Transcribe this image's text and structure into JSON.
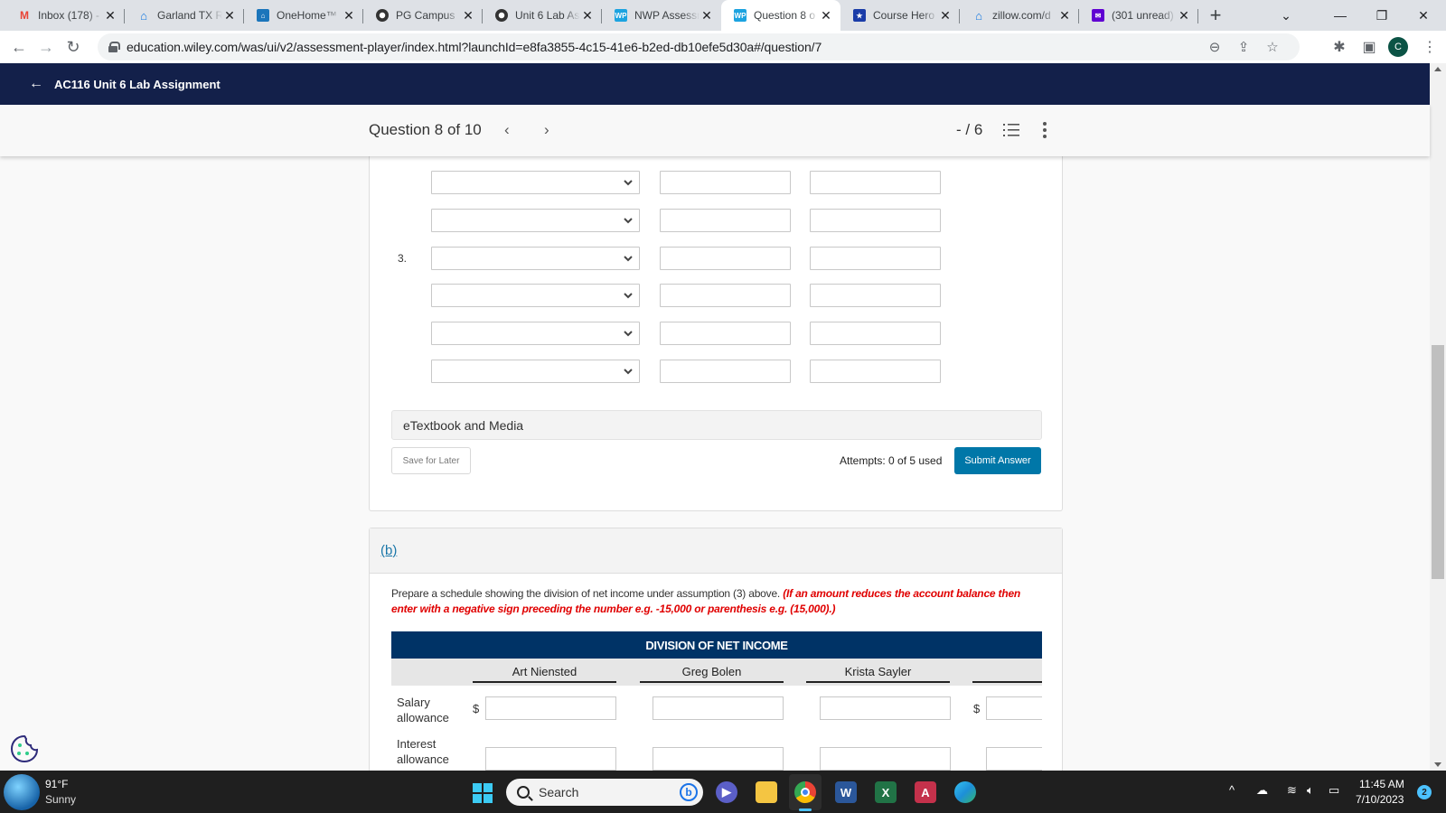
{
  "browser": {
    "tabs": [
      {
        "label": "Inbox (178) -",
        "icon": "gmail-icon",
        "icon_color": "#ea4335",
        "active": false
      },
      {
        "label": "Garland TX R",
        "icon": "zillow-icon",
        "icon_color": "#1277e1",
        "active": false
      },
      {
        "label": "OneHome™",
        "icon": "onehome-icon",
        "icon_color": "#1b75bb",
        "active": false
      },
      {
        "label": "PG Campus",
        "icon": "campus-icon",
        "icon_color": "#333333",
        "active": false
      },
      {
        "label": "Unit 6 Lab As",
        "icon": "campus-icon",
        "icon_color": "#333333",
        "active": false
      },
      {
        "label": "NWP Assessm",
        "icon": "wp-icon",
        "icon_color": "#1ca3e0",
        "active": false
      },
      {
        "label": "Question 8 o",
        "icon": "wp-icon",
        "icon_color": "#1ca3e0",
        "active": true
      },
      {
        "label": "Course Hero",
        "icon": "coursehero-icon",
        "icon_color": "#1a3ca8",
        "active": false
      },
      {
        "label": "zillow.com/d",
        "icon": "zillow-icon",
        "icon_color": "#1277e1",
        "active": false
      },
      {
        "label": "(301 unread)",
        "icon": "yahoo-mail-icon",
        "icon_color": "#6001d2",
        "active": false
      }
    ],
    "new_tab_label": "+",
    "url": "education.wiley.com/was/ui/v2/assessment-player/index.html?launchId=e8fa3855-4c15-41e6-b2ed-db10efe5d30a#/question/7",
    "profile_initial": "C"
  },
  "app": {
    "assignment_title": "AC116 Unit 6 Lab Assignment",
    "question_label": "Question 8 of 10",
    "score": "- / 6"
  },
  "part_a": {
    "row_numbers": [
      "",
      "",
      "3.",
      "",
      "",
      ""
    ],
    "rows": 6,
    "etextbook_label": "eTextbook and Media",
    "save_later_label": "Save for Later",
    "attempts_label": "Attempts: 0 of 5 used",
    "submit_label": "Submit Answer"
  },
  "part_b": {
    "label": "(b)",
    "prompt": "Prepare a schedule showing the division of net income under assumption (3) above.",
    "prompt_note": "(If an amount reduces the account balance then enter with a negative sign preceding the number e.g. -15,000 or parenthesis e.g. (15,000).)",
    "table_title": "DIVISION OF NET INCOME",
    "columns": [
      "Art Niensted",
      "Greg Bolen",
      "Krista Sayler",
      ""
    ],
    "rows": [
      {
        "label": "Salary allowance",
        "dollar_signs": true
      },
      {
        "label": "Interest allowance",
        "dollar_signs": false
      }
    ],
    "dollar": "$"
  },
  "taskbar": {
    "weather_temp": "91°F",
    "weather_desc": "Sunny",
    "search_placeholder": "Search",
    "time": "11:45 AM",
    "date": "7/10/2023",
    "notification_count": "2"
  },
  "colors": {
    "header_navy": "#13204a",
    "table_header": "#003366",
    "submit_blue": "#0077a8",
    "warning_red": "#e00000",
    "link_blue": "#1976a8"
  }
}
